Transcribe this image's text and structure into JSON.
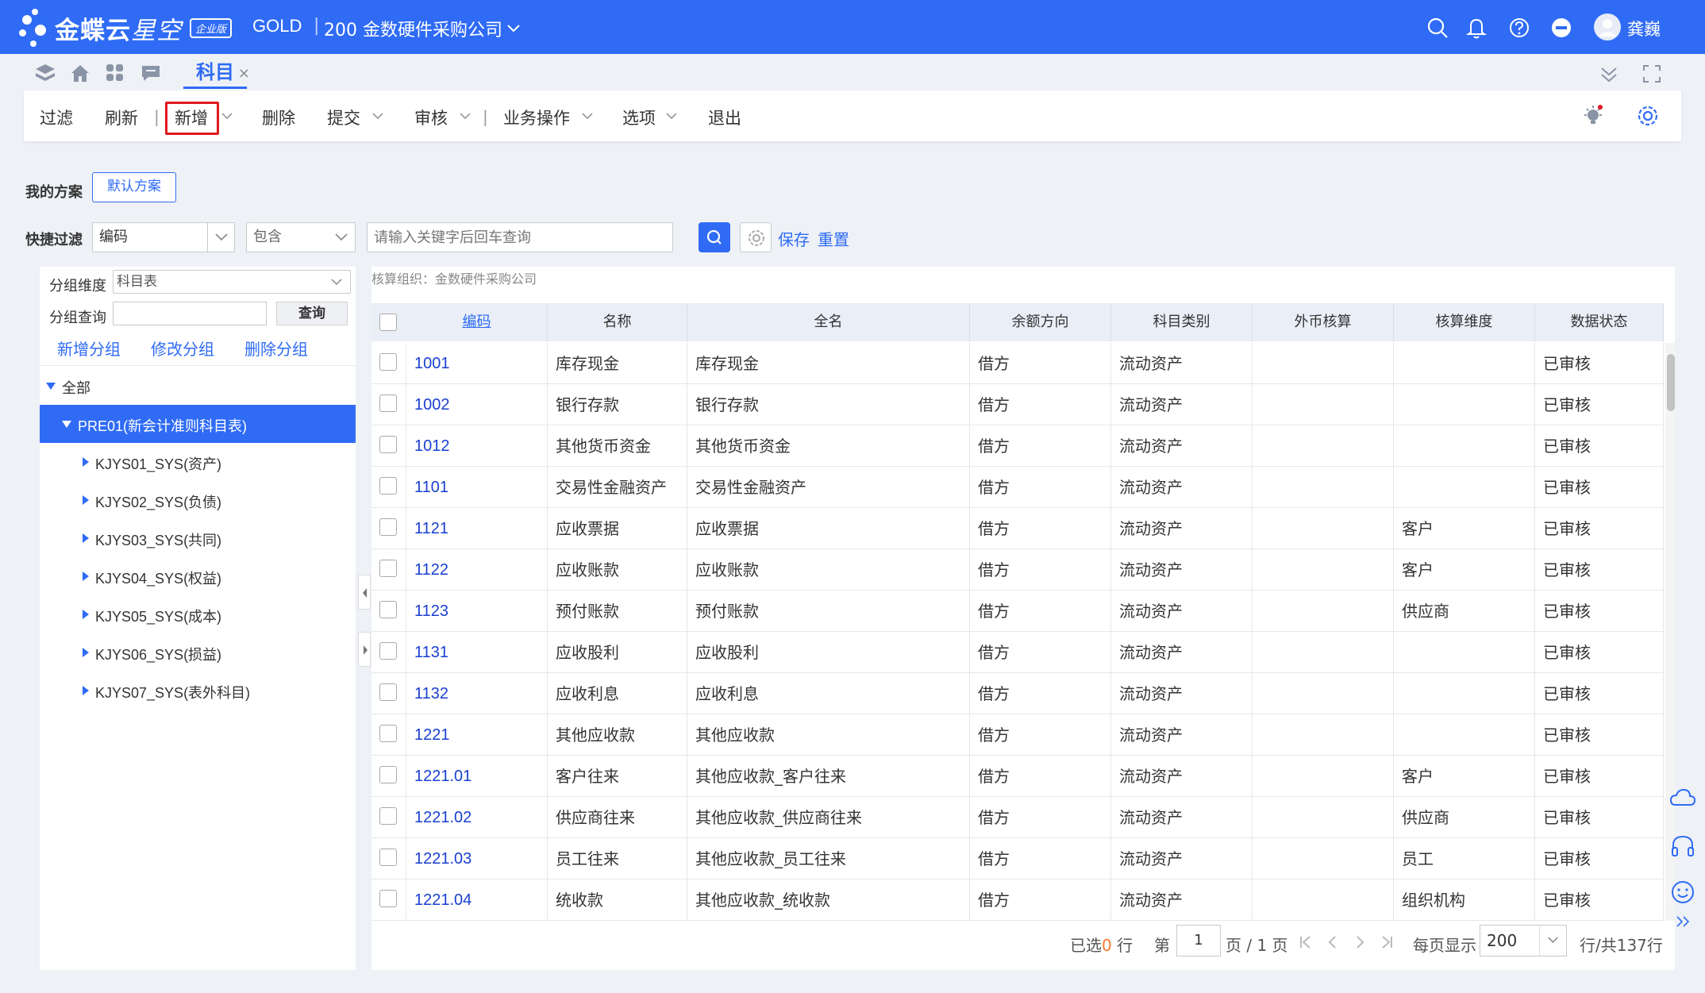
{
  "app": {
    "logo_text": "金蝶云",
    "logo_sub": "星空",
    "logo_badge": "企业版",
    "org_code": "GOLD",
    "org_separator": "|",
    "org_name": "200 金数硬件采购公司",
    "user_name": "龚巍"
  },
  "tab": {
    "label": "科目",
    "close": "×"
  },
  "toolbar": {
    "filter": "过滤",
    "refresh": "刷新",
    "add": "新增",
    "delete": "删除",
    "submit": "提交",
    "audit": "审核",
    "business": "业务操作",
    "options": "选项",
    "exit": "退出",
    "separator": "|"
  },
  "scheme": {
    "label": "我的方案",
    "default": "默认方案"
  },
  "quick_filter": {
    "label": "快捷过滤",
    "field": "编码",
    "operator": "包含",
    "placeholder": "请输入关键字后回车查询",
    "save": "保存",
    "reset": "重置"
  },
  "group": {
    "dimension_label": "分组维度",
    "dimension_value": "科目表",
    "query_label": "分组查询",
    "query_button": "查询",
    "add": "新增分组",
    "edit": "修改分组",
    "delete": "删除分组",
    "tree": [
      {
        "label": "全部",
        "level": 0,
        "expanded": true
      },
      {
        "label": "PRE01(新会计准则科目表)",
        "level": 1,
        "expanded": true,
        "selected": true
      },
      {
        "label": "KJYS01_SYS(资产)",
        "level": 2
      },
      {
        "label": "KJYS02_SYS(负债)",
        "level": 2
      },
      {
        "label": "KJYS03_SYS(共同)",
        "level": 2
      },
      {
        "label": "KJYS04_SYS(权益)",
        "level": 2
      },
      {
        "label": "KJYS05_SYS(成本)",
        "level": 2
      },
      {
        "label": "KJYS06_SYS(损益)",
        "level": 2
      },
      {
        "label": "KJYS07_SYS(表外科目)",
        "level": 2
      }
    ]
  },
  "grid": {
    "caption": "核算组织：金数硬件采购公司",
    "columns": [
      "编码",
      "名称",
      "全名",
      "余额方向",
      "科目类别",
      "外币核算",
      "核算维度",
      "数据状态"
    ],
    "rows": [
      [
        "1001",
        "库存现金",
        "库存现金",
        "借方",
        "流动资产",
        "",
        "",
        "已审核"
      ],
      [
        "1002",
        "银行存款",
        "银行存款",
        "借方",
        "流动资产",
        "",
        "",
        "已审核"
      ],
      [
        "1012",
        "其他货币资金",
        "其他货币资金",
        "借方",
        "流动资产",
        "",
        "",
        "已审核"
      ],
      [
        "1101",
        "交易性金融资产",
        "交易性金融资产",
        "借方",
        "流动资产",
        "",
        "",
        "已审核"
      ],
      [
        "1121",
        "应收票据",
        "应收票据",
        "借方",
        "流动资产",
        "",
        "客户",
        "已审核"
      ],
      [
        "1122",
        "应收账款",
        "应收账款",
        "借方",
        "流动资产",
        "",
        "客户",
        "已审核"
      ],
      [
        "1123",
        "预付账款",
        "预付账款",
        "借方",
        "流动资产",
        "",
        "供应商",
        "已审核"
      ],
      [
        "1131",
        "应收股利",
        "应收股利",
        "借方",
        "流动资产",
        "",
        "",
        "已审核"
      ],
      [
        "1132",
        "应收利息",
        "应收利息",
        "借方",
        "流动资产",
        "",
        "",
        "已审核"
      ],
      [
        "1221",
        "其他应收款",
        "其他应收款",
        "借方",
        "流动资产",
        "",
        "",
        "已审核"
      ],
      [
        "1221.01",
        "客户往来",
        "其他应收款_客户往来",
        "借方",
        "流动资产",
        "",
        "客户",
        "已审核"
      ],
      [
        "1221.02",
        "供应商往来",
        "其他应收款_供应商往来",
        "借方",
        "流动资产",
        "",
        "供应商",
        "已审核"
      ],
      [
        "1221.03",
        "员工往来",
        "其他应收款_员工往来",
        "借方",
        "流动资产",
        "",
        "员工",
        "已审核"
      ],
      [
        "1221.04",
        "统收款",
        "其他应收款_统收款",
        "借方",
        "流动资产",
        "",
        "组织机构",
        "已审核"
      ]
    ]
  },
  "pager": {
    "selected_prefix": "已选",
    "selected_count": "0",
    "selected_suffix": "行",
    "page_prefix": "第",
    "page": "1",
    "page_suffix": "页 / 1 页",
    "per_page_label": "每页显示",
    "per_page": "200",
    "total": "行/共137行"
  },
  "colors": {
    "primary": "#2f6bf5",
    "highlight": "#e0181e",
    "link": "#1a3fd0",
    "count": "#f5792a"
  },
  "icons": [
    "search-icon",
    "bell-icon",
    "help-icon",
    "minus-circle-icon",
    "avatar",
    "home-icon",
    "grid-icon",
    "chat-icon",
    "gear-icon",
    "bulb-icon",
    "cloud-icon",
    "headset-icon",
    "smile-icon"
  ]
}
